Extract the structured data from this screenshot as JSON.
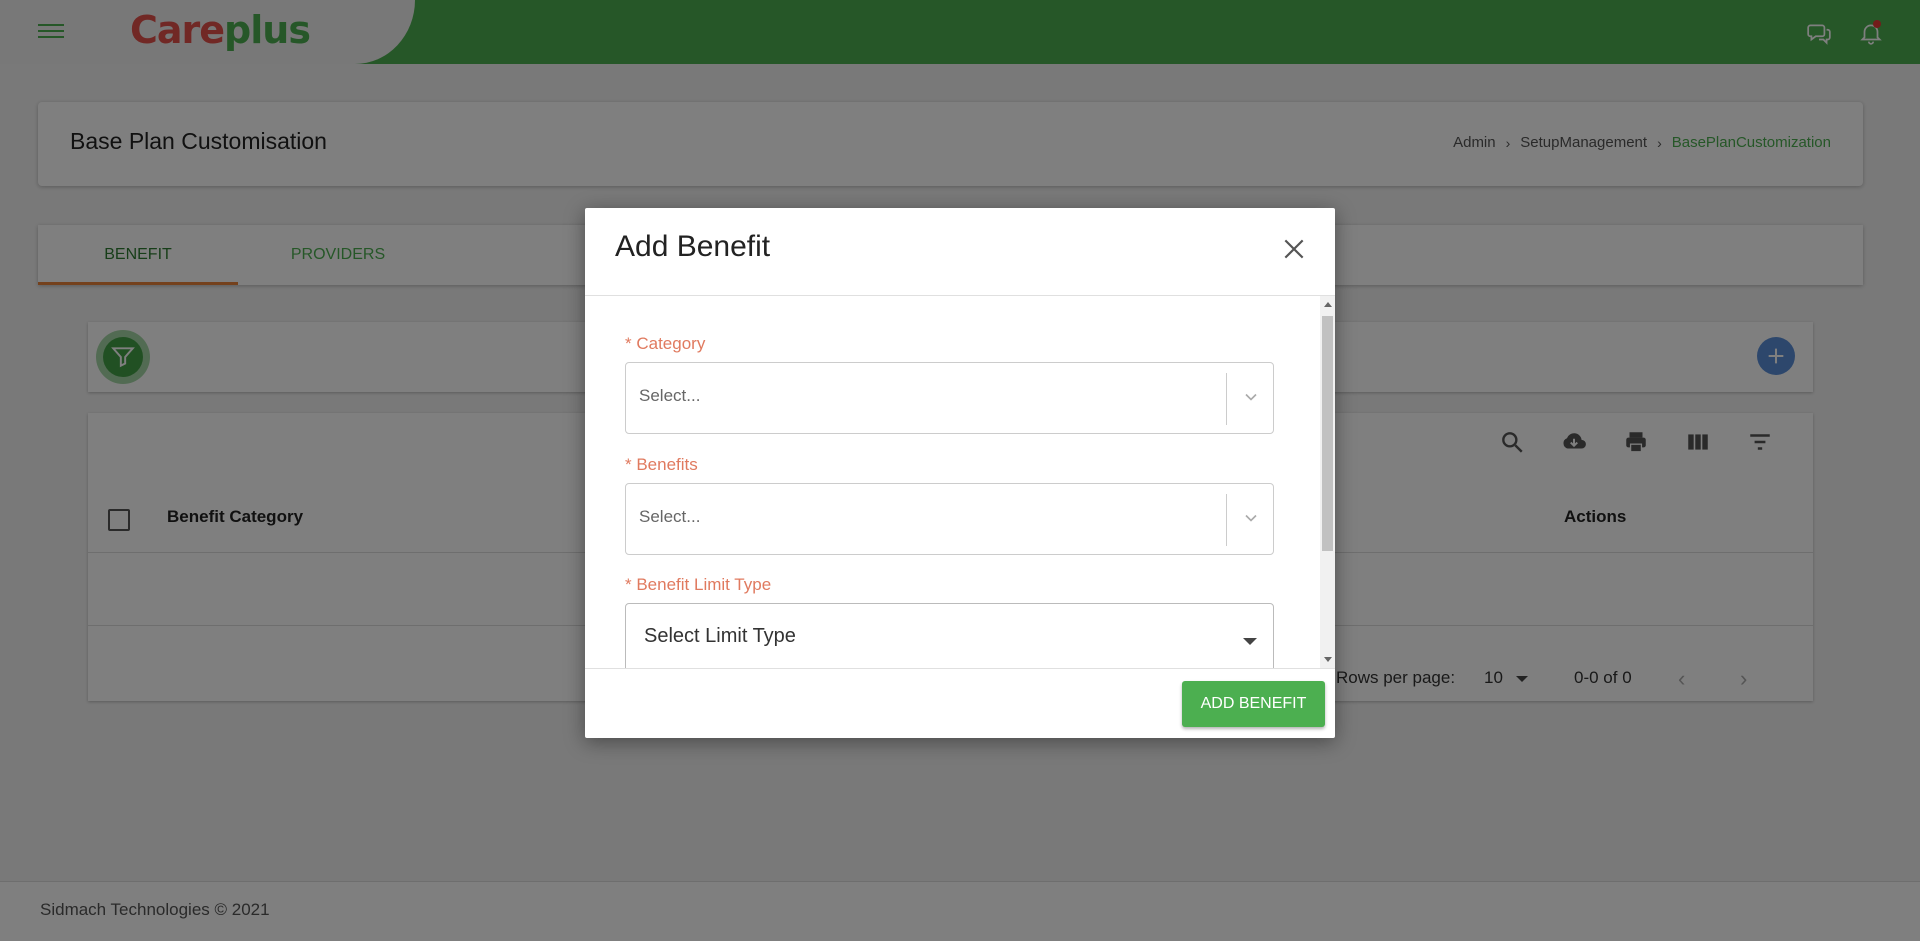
{
  "header": {
    "logo_part1": "Care",
    "logo_part2": "plus",
    "menu_icon": "hamburger-menu-icon",
    "chat_icon": "chat-bubbles-icon",
    "bell_icon": "notification-bell-icon"
  },
  "page": {
    "title": "Base Plan Customisation",
    "breadcrumb": [
      "Admin",
      "SetupManagement",
      "BasePlanCustomization"
    ]
  },
  "tabs": [
    {
      "label": "BENEFIT",
      "active": true
    },
    {
      "label": "PROVIDERS",
      "active": false
    }
  ],
  "table": {
    "columns": [
      "Benefit Category",
      "Actions"
    ],
    "toolbar_icons": [
      "search-icon",
      "download-icon",
      "print-icon",
      "view-columns-icon",
      "filter-list-icon"
    ],
    "rows_per_page_label": "Rows per page:",
    "rows_per_page_value": "10",
    "page_range": "0-0 of 0"
  },
  "footer": {
    "text": "Sidmach Technologies © 2021"
  },
  "modal": {
    "title": "Add Benefit",
    "fields": [
      {
        "label": "* Category",
        "placeholder": "Select..."
      },
      {
        "label": "* Benefits",
        "placeholder": "Select..."
      },
      {
        "label": "* Benefit Limit Type",
        "value": "Select Limit Type"
      }
    ],
    "submit_label": "ADD BENEFIT"
  },
  "colors": {
    "brand_green": "#4caf50",
    "brand_red": "#e2504a",
    "label_orange": "#e07a5f",
    "tab_underline": "#e8833a",
    "add_button_blue": "#5b8fd9"
  }
}
